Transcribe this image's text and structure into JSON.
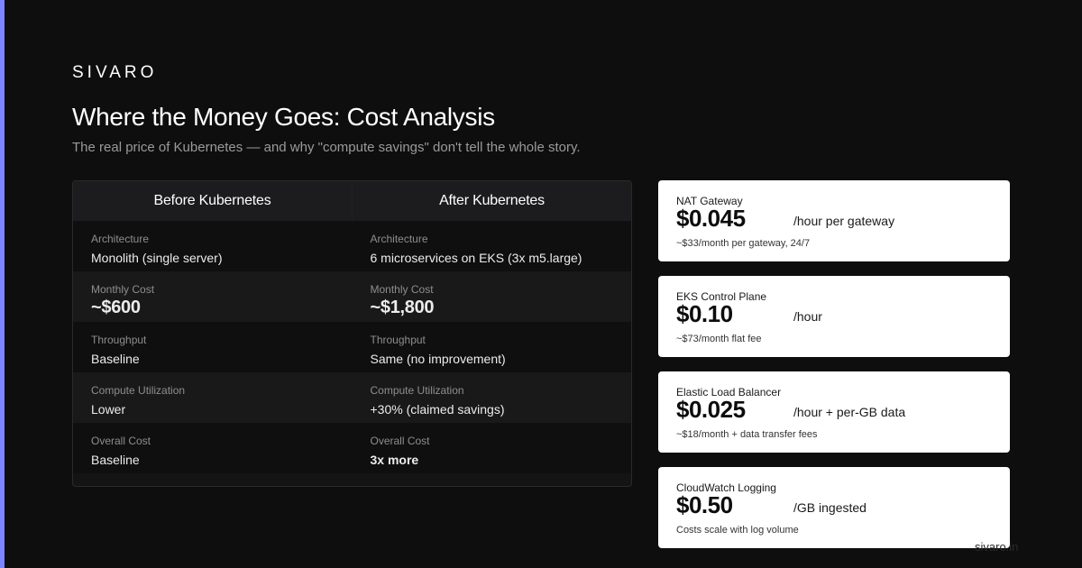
{
  "brand": "SIVARO",
  "title": "Where the Money Goes: Cost Analysis",
  "subtitle": "The real price of Kubernetes — and why \"compute savings\" don't tell the whole story.",
  "table": {
    "headers": [
      "Before Kubernetes",
      "After Kubernetes"
    ],
    "rows": [
      {
        "before": {
          "label": "Architecture",
          "value": "Monolith (single server)"
        },
        "after": {
          "label": "Architecture",
          "value": "6 microservices on EKS (3x m5.large)"
        }
      },
      {
        "before": {
          "label": "Monthly Cost",
          "value": "~$600"
        },
        "after": {
          "label": "Monthly Cost",
          "value": "~$1,800"
        }
      },
      {
        "before": {
          "label": "Throughput",
          "value": "Baseline"
        },
        "after": {
          "label": "Throughput",
          "value": "Same (no improvement)"
        }
      },
      {
        "before": {
          "label": "Compute Utilization",
          "value": "Lower"
        },
        "after": {
          "label": "Compute Utilization",
          "value": "+30% (claimed savings)"
        }
      },
      {
        "before": {
          "label": "Overall Cost",
          "value": "Baseline"
        },
        "after": {
          "label": "Overall Cost",
          "value": "3x more"
        }
      }
    ]
  },
  "cards": [
    {
      "name": "NAT Gateway",
      "price": "$0.045",
      "unit": "/hour per gateway",
      "note": "~$33/month per gateway, 24/7"
    },
    {
      "name": "EKS Control Plane",
      "price": "$0.10",
      "unit": "/hour",
      "note": "~$73/month flat fee"
    },
    {
      "name": "Elastic Load Balancer",
      "price": "$0.025",
      "unit": "/hour + per-GB data",
      "note": "~$18/month + data transfer fees"
    },
    {
      "name": "CloudWatch Logging",
      "price": "$0.50",
      "unit": "/GB ingested",
      "note": "Costs scale with log volume"
    }
  ],
  "footer_url": "sivaro.in",
  "colors": {
    "accent": "#7b86ff",
    "background": "#0e0e0f",
    "card": "#ffffff"
  }
}
